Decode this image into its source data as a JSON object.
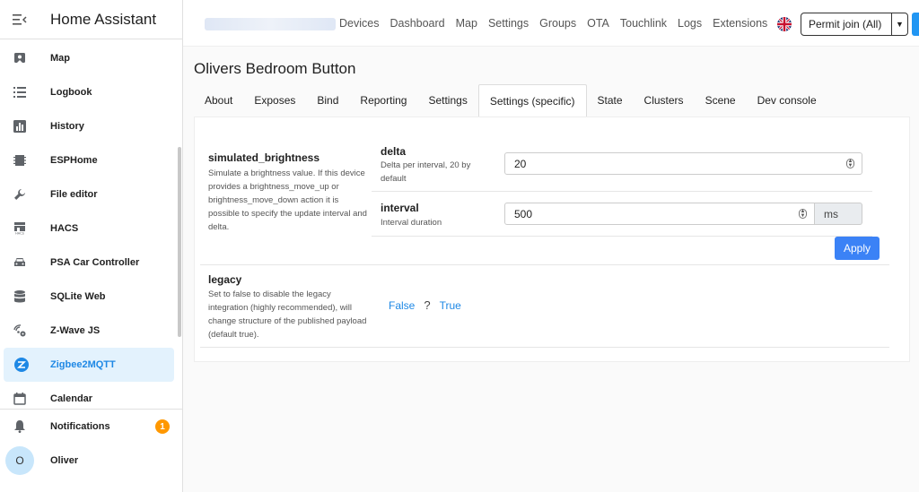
{
  "app": {
    "title": "Home Assistant"
  },
  "sidebar": {
    "items": [
      {
        "label": "Map",
        "icon": "map-icon"
      },
      {
        "label": "Logbook",
        "icon": "logbook-icon"
      },
      {
        "label": "History",
        "icon": "history-icon"
      },
      {
        "label": "ESPHome",
        "icon": "esphome-icon"
      },
      {
        "label": "File editor",
        "icon": "wrench-icon"
      },
      {
        "label": "HACS",
        "icon": "hacs-icon"
      },
      {
        "label": "PSA Car Controller",
        "icon": "car-icon"
      },
      {
        "label": "SQLite Web",
        "icon": "database-icon"
      },
      {
        "label": "Z-Wave JS",
        "icon": "zwave-icon"
      },
      {
        "label": "Zigbee2MQTT",
        "icon": "zigbee-icon",
        "active": true
      },
      {
        "label": "Calendar",
        "icon": "calendar-icon"
      }
    ],
    "bottom": {
      "notifications": {
        "label": "Notifications",
        "count": "1"
      },
      "user": {
        "label": "Oliver",
        "initial": "O"
      }
    }
  },
  "topnav": {
    "links": [
      "Devices",
      "Dashboard",
      "Map",
      "Settings",
      "Groups",
      "OTA",
      "Touchlink",
      "Logs",
      "Extensions"
    ],
    "permit_join": "Permit join (All)"
  },
  "device": {
    "title": "Olivers Bedroom Button"
  },
  "tabs": [
    "About",
    "Exposes",
    "Bind",
    "Reporting",
    "Settings",
    "Settings (specific)",
    "State",
    "Clusters",
    "Scene",
    "Dev console"
  ],
  "active_tab": "Settings (specific)",
  "settings": {
    "simulated_brightness": {
      "title": "simulated_brightness",
      "desc": "Simulate a brightness value. If this device provides a brightness_move_up or brightness_move_down action it is possible to specify the update interval and delta.",
      "delta": {
        "name": "delta",
        "hint": "Delta per interval, 20 by default",
        "value": "20"
      },
      "interval": {
        "name": "interval",
        "hint": "Interval duration",
        "value": "500",
        "unit": "ms"
      },
      "apply": "Apply"
    },
    "legacy": {
      "title": "legacy",
      "desc": "Set to false to disable the legacy integration (highly recommended), will change structure of the published payload (default true).",
      "false_label": "False",
      "unknown": "?",
      "true_label": "True"
    }
  },
  "colors": {
    "accent": "#1e88e5",
    "apply": "#3b82f6",
    "badge": "#ff9800"
  }
}
